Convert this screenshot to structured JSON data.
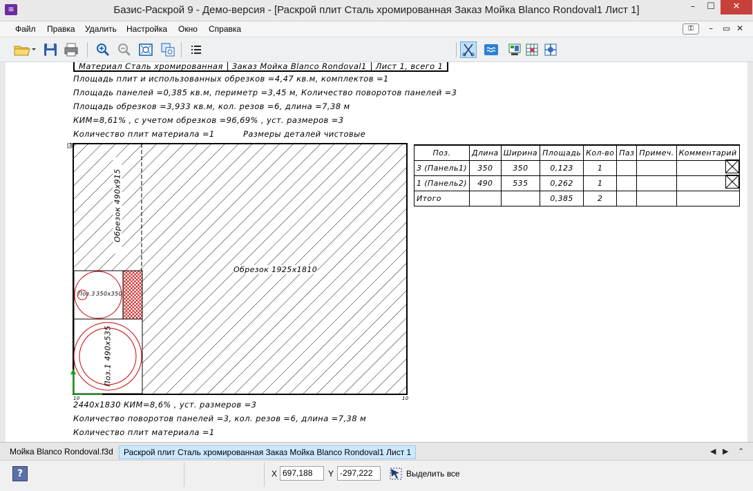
{
  "window": {
    "title": "Базис-Раскрой 9 - Демо-версия - [Раскрой плит Сталь хромированная Заказ Мойка Blanco Rondoval1 Лист 1]",
    "app_icon": "app-logo-icon",
    "controls": {
      "minimize": "–",
      "maximize": "☐",
      "close": "✕"
    }
  },
  "menubar": {
    "items": [
      "Файл",
      "Правка",
      "Удалить",
      "Настройка",
      "Окно",
      "Справка"
    ],
    "mdi": {
      "minimize": "–",
      "restore": "▭",
      "close": "✕"
    }
  },
  "toolbar": {
    "icons": [
      "open-folder-icon",
      "save-icon",
      "print-icon",
      "zoom-in-icon",
      "zoom-out-icon",
      "zoom-fit-icon",
      "zoom-window-icon",
      "list-icon",
      "cut-tool-icon",
      "sheet-icon",
      "layout-icon",
      "grid-icon",
      "settings-icon"
    ]
  },
  "document": {
    "header_cells": [
      "Материал Сталь хромированная",
      "Заказ Мойка Blanco Rondoval1",
      "Лист 1, всего 1"
    ],
    "info_lines": [
      "Площадь плит и использованных обрезков =4,47 кв.м, комплектов =1",
      "Площадь панелей =0,385 кв.м, периметр =3,45 м, Количество поворотов панелей =3",
      "Площадь обрезков =3,933 кв.м, кол. резов =6, длина =7,38 м",
      "КИМ=8,61% , с учетом обрезков =96,69% , уст. размеров =3",
      "Количество плит материала =1",
      "Размеры деталей чистовые"
    ],
    "layout_labels": {
      "offcut_top": "Обрезок 490х915",
      "offcut_big": "Обрезок 1925х1810",
      "part_small": "Поз.3 350х350",
      "part_small_short": "Поз.3",
      "part_small_size": "350х350",
      "part_large": "Поз.1 490х535",
      "corner_tl": "10",
      "corner_bl": "10",
      "corner_br": "10"
    },
    "footer_lines": [
      "2440х1830 КИМ=8,6% , уст. размеров =3",
      "Количество поворотов панелей =3, кол. резов =6, длина =7,38 м",
      "Количество плит материала =1"
    ],
    "table": {
      "headers": [
        "Поз.",
        "Длина",
        "Ширина",
        "Площадь",
        "Кол-во",
        "Паз",
        "Примеч.",
        "Комментарий"
      ],
      "rows": [
        [
          "3 (Панель1)",
          "350",
          "350",
          "0,123",
          "1",
          "",
          "",
          ""
        ],
        [
          "1 (Панель2)",
          "490",
          "535",
          "0,262",
          "1",
          "",
          "",
          ""
        ],
        [
          "Итого",
          "",
          "",
          "0,385",
          "2",
          "",
          "",
          ""
        ]
      ]
    }
  },
  "tabs": {
    "items": [
      "Мойка Blanco Rondoval.f3d",
      "Раскрой плит Сталь хромированная Заказ Мойка Blanco Rondoval1 Лист 1"
    ],
    "active": 1,
    "arrows": [
      "◀",
      "▶",
      "⌃"
    ]
  },
  "statusbar": {
    "help": "?",
    "x_label": "X",
    "x_value": "697,188",
    "y_label": "Y",
    "y_value": "-297,222",
    "select_all": "Выделить все"
  }
}
